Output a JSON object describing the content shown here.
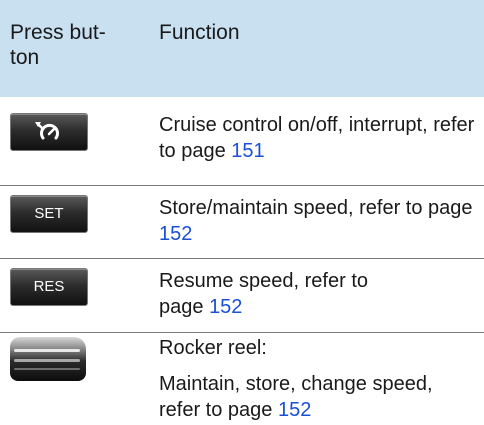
{
  "header": {
    "col_button_line1": "Press but-",
    "col_button_line2": "ton",
    "col_function": "Function"
  },
  "rows": [
    {
      "button_icon": "cruise-control-icon",
      "func_text": "Cruise control on/off, interrupt, refer to page ",
      "page": "151"
    },
    {
      "button_label": "SET",
      "func_text": "Store/maintain speed, refer to page ",
      "page": "152"
    },
    {
      "button_label": "RES",
      "func_text": "Resume speed, refer to page ",
      "page": "152"
    },
    {
      "button_icon": "rocker-reel-icon",
      "func_title": "Rocker reel:",
      "func_text": "Maintain, store, change speed, refer to page ",
      "page": "152"
    }
  ],
  "colors": {
    "header_bg": "#c9e0f1",
    "link": "#1a4fd6"
  }
}
